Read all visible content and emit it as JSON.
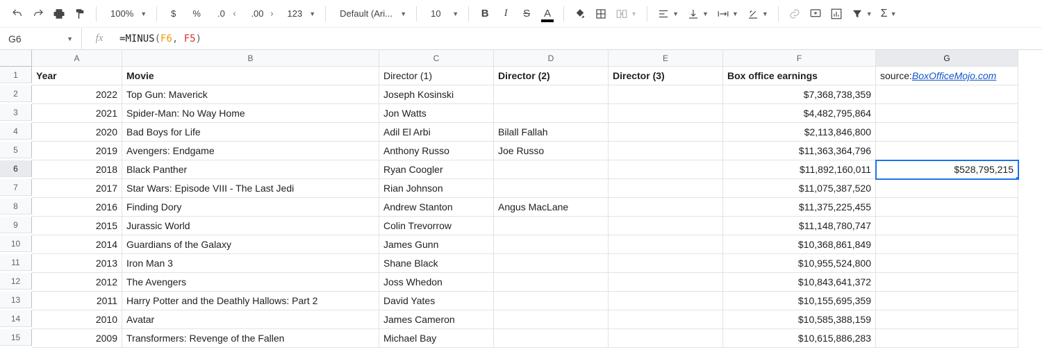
{
  "toolbar": {
    "zoom": "100%",
    "font_family": "Default (Ari...",
    "font_size": "10",
    "number_format_123": "123"
  },
  "namebox": {
    "ref": "G6"
  },
  "formula": {
    "prefix": "=",
    "fn": "MINUS",
    "open": "(",
    "arg1": "F6",
    "comma": ", ",
    "arg2": "F5",
    "close": ")"
  },
  "columns": [
    "A",
    "B",
    "C",
    "D",
    "E",
    "F",
    "G"
  ],
  "headers": {
    "A": "Year",
    "B": "Movie",
    "C": "Director (1)",
    "D": "Director (2)",
    "E": "Director (3)",
    "F": "Box office earnings",
    "G_prefix": "source: ",
    "G_link": "BoxOfficeMojo.com"
  },
  "selected": {
    "col": "G",
    "row": 6,
    "value": "$528,795,215"
  },
  "rows": [
    {
      "n": 2,
      "year": "2022",
      "movie": "Top Gun: Maverick",
      "d1": "Joseph Kosinski",
      "d2": "",
      "d3": "",
      "box": "$7,368,738,359",
      "g": ""
    },
    {
      "n": 3,
      "year": "2021",
      "movie": "Spider-Man: No Way Home",
      "d1": "Jon Watts",
      "d2": "",
      "d3": "",
      "box": "$4,482,795,864",
      "g": ""
    },
    {
      "n": 4,
      "year": "2020",
      "movie": "Bad Boys for Life",
      "d1": "Adil El Arbi",
      "d2": "Bilall Fallah",
      "d3": "",
      "box": "$2,113,846,800",
      "g": ""
    },
    {
      "n": 5,
      "year": "2019",
      "movie": "Avengers: Endgame",
      "d1": "Anthony Russo",
      "d2": "Joe Russo",
      "d3": "",
      "box": "$11,363,364,796",
      "g": ""
    },
    {
      "n": 6,
      "year": "2018",
      "movie": "Black Panther",
      "d1": "Ryan Coogler",
      "d2": "",
      "d3": "",
      "box": "$11,892,160,011",
      "g": "$528,795,215"
    },
    {
      "n": 7,
      "year": "2017",
      "movie": "Star Wars: Episode VIII - The Last Jedi",
      "d1": "Rian Johnson",
      "d2": "",
      "d3": "",
      "box": "$11,075,387,520",
      "g": ""
    },
    {
      "n": 8,
      "year": "2016",
      "movie": "Finding Dory",
      "d1": "Andrew Stanton",
      "d2": "Angus MacLane",
      "d3": "",
      "box": "$11,375,225,455",
      "g": ""
    },
    {
      "n": 9,
      "year": "2015",
      "movie": "Jurassic World",
      "d1": "Colin Trevorrow",
      "d2": "",
      "d3": "",
      "box": "$11,148,780,747",
      "g": ""
    },
    {
      "n": 10,
      "year": "2014",
      "movie": "Guardians of the Galaxy",
      "d1": "James Gunn",
      "d2": "",
      "d3": "",
      "box": "$10,368,861,849",
      "g": ""
    },
    {
      "n": 11,
      "year": "2013",
      "movie": "Iron Man 3",
      "d1": "Shane Black",
      "d2": "",
      "d3": "",
      "box": "$10,955,524,800",
      "g": ""
    },
    {
      "n": 12,
      "year": "2012",
      "movie": "The Avengers",
      "d1": "Joss Whedon",
      "d2": "",
      "d3": "",
      "box": "$10,843,641,372",
      "g": ""
    },
    {
      "n": 13,
      "year": "2011",
      "movie": "Harry Potter and the Deathly Hallows: Part 2",
      "d1": "David Yates",
      "d2": "",
      "d3": "",
      "box": "$10,155,695,359",
      "g": ""
    },
    {
      "n": 14,
      "year": "2010",
      "movie": "Avatar",
      "d1": "James Cameron",
      "d2": "",
      "d3": "",
      "box": "$10,585,388,159",
      "g": ""
    },
    {
      "n": 15,
      "year": "2009",
      "movie": "Transformers: Revenge of the Fallen",
      "d1": "Michael Bay",
      "d2": "",
      "d3": "",
      "box": "$10,615,886,283",
      "g": ""
    }
  ]
}
